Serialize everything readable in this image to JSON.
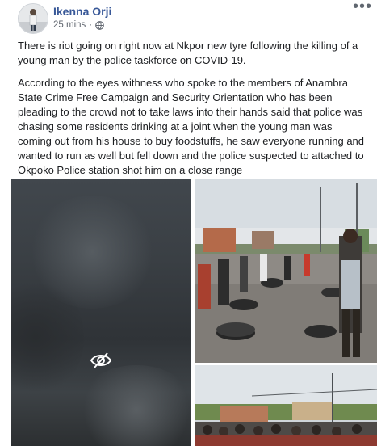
{
  "post": {
    "author": "Ikenna Orji",
    "time": "25 mins",
    "separator": "·",
    "privacy_icon": "globe-icon",
    "more_icon": "more-options-icon",
    "paragraphs": [
      "There is riot going on right now at Nkpor new tyre following the killing of a young man by the police taskforce on COVID-19.",
      "According to the eyes withness who spoke to the members of Anambra State Crime Free Campaign and Security Orientation who has been pleading to the crowd not to take laws into their hands said that police was chasing some residents drinking at a joint when the young man was coming out from his house to buy foodstuffs, he saw everyone running and wanted to run as well but fell down and the police suspected to attached to Okpoko Police station shot him on a close range"
    ]
  },
  "media": {
    "left_overlay_icon": "sensitive-content-eye-icon",
    "photos": [
      "blurred-photo",
      "street-riot-photo",
      "crowd-photo"
    ]
  },
  "colors": {
    "author": "#385898",
    "meta": "#616770",
    "text": "#1c1e21"
  }
}
